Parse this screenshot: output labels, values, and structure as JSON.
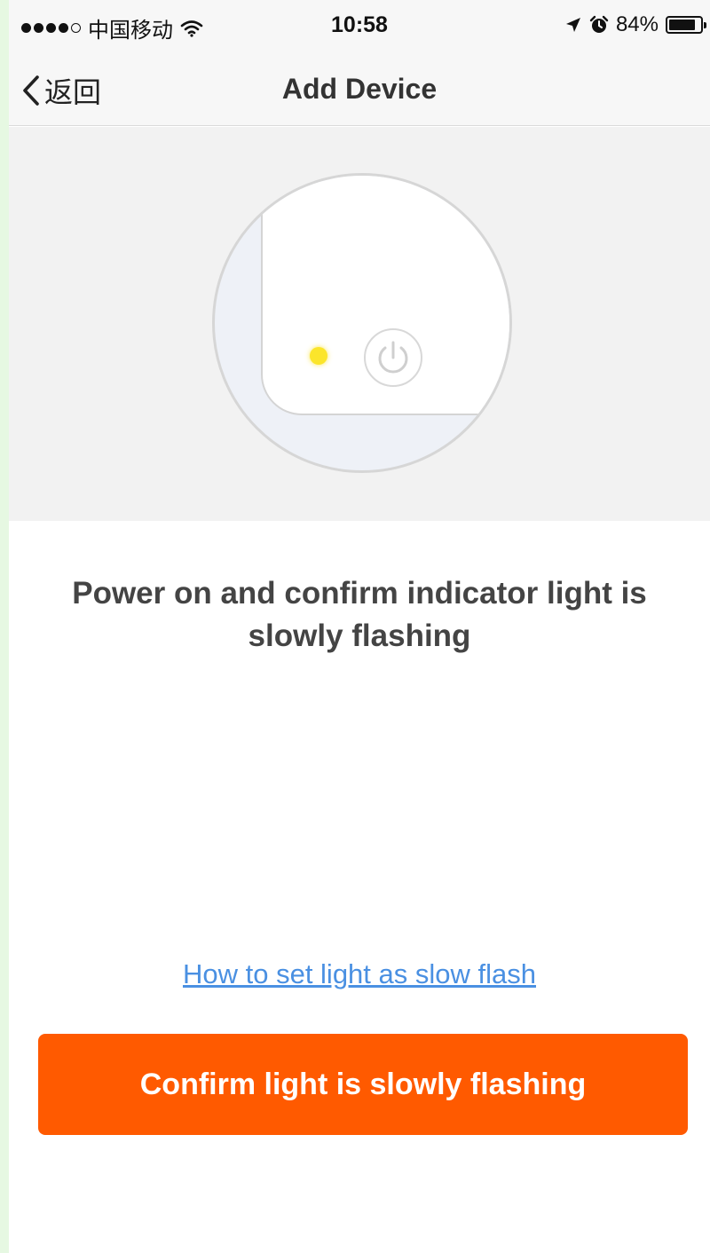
{
  "status_bar": {
    "carrier": "中国移动",
    "time": "10:58",
    "battery_percent": "84%",
    "battery_level": 0.84,
    "icons": [
      "signal-dots-icon",
      "wifi-icon",
      "location-arrow-icon",
      "alarm-clock-icon",
      "battery-icon"
    ]
  },
  "nav": {
    "back_label": "返回",
    "title": "Add Device"
  },
  "illustration": {
    "led_color": "#fbe52b",
    "icons": [
      "power-icon"
    ]
  },
  "main": {
    "instruction": "Power on and confirm indicator light is slowly flashing",
    "help_link": "How to set light as slow flash",
    "confirm_button": "Confirm light is slowly flashing"
  },
  "colors": {
    "accent": "#ff5a00",
    "link": "#4a90e2"
  }
}
